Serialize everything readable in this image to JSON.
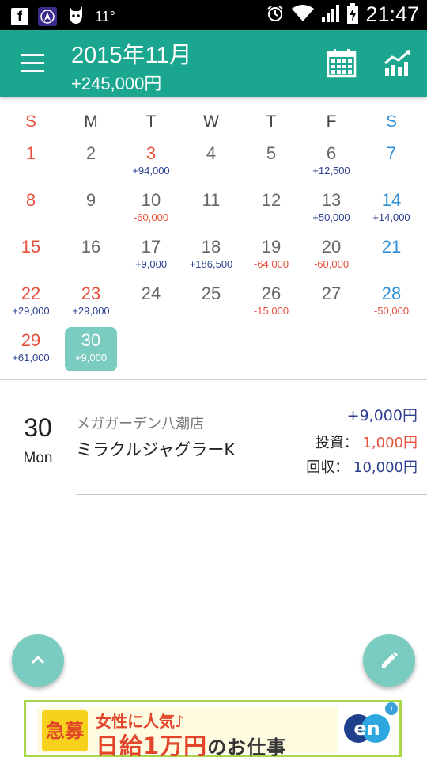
{
  "status_bar": {
    "temperature": "11°",
    "time": "21:47"
  },
  "header": {
    "title": "2015年11月",
    "total": "+245,000円"
  },
  "weekdays": [
    "S",
    "M",
    "T",
    "W",
    "T",
    "F",
    "S"
  ],
  "calendar": {
    "weeks": [
      [
        {
          "day": "1",
          "amount": "",
          "color": "red"
        },
        {
          "day": "2",
          "amount": "",
          "color": "gray"
        },
        {
          "day": "3",
          "amount": "+94,000",
          "color": "red"
        },
        {
          "day": "4",
          "amount": "",
          "color": "gray"
        },
        {
          "day": "5",
          "amount": "",
          "color": "gray"
        },
        {
          "day": "6",
          "amount": "+12,500",
          "color": "gray"
        },
        {
          "day": "7",
          "amount": "",
          "color": "blue"
        }
      ],
      [
        {
          "day": "8",
          "amount": "",
          "color": "red"
        },
        {
          "day": "9",
          "amount": "",
          "color": "gray"
        },
        {
          "day": "10",
          "amount": "-60,000",
          "color": "gray"
        },
        {
          "day": "11",
          "amount": "",
          "color": "gray"
        },
        {
          "day": "12",
          "amount": "",
          "color": "gray"
        },
        {
          "day": "13",
          "amount": "+50,000",
          "color": "gray"
        },
        {
          "day": "14",
          "amount": "+14,000",
          "color": "blue"
        }
      ],
      [
        {
          "day": "15",
          "amount": "",
          "color": "red"
        },
        {
          "day": "16",
          "amount": "",
          "color": "gray"
        },
        {
          "day": "17",
          "amount": "+9,000",
          "color": "gray"
        },
        {
          "day": "18",
          "amount": "+186,500",
          "color": "gray"
        },
        {
          "day": "19",
          "amount": "-64,000",
          "color": "gray"
        },
        {
          "day": "20",
          "amount": "-60,000",
          "color": "gray"
        },
        {
          "day": "21",
          "amount": "",
          "color": "blue"
        }
      ],
      [
        {
          "day": "22",
          "amount": "+29,000",
          "color": "red"
        },
        {
          "day": "23",
          "amount": "+29,000",
          "color": "red"
        },
        {
          "day": "24",
          "amount": "",
          "color": "gray"
        },
        {
          "day": "25",
          "amount": "",
          "color": "gray"
        },
        {
          "day": "26",
          "amount": "-15,000",
          "color": "gray"
        },
        {
          "day": "27",
          "amount": "",
          "color": "gray"
        },
        {
          "day": "28",
          "amount": "-50,000",
          "color": "blue"
        }
      ],
      [
        {
          "day": "29",
          "amount": "+61,000",
          "color": "red"
        },
        {
          "day": "30",
          "amount": "+9,000",
          "color": "gray",
          "selected": true
        }
      ]
    ]
  },
  "entry": {
    "day": "30",
    "weekday": "Mon",
    "store": "メガガーデン八潮店",
    "machine": "ミラクルジャグラーK",
    "profit": "+9,000円",
    "invest_label": "投資：",
    "invest_value": "1,000円",
    "return_label": "回収：",
    "return_value": "10,000円"
  },
  "ad": {
    "badge": "急募",
    "line1": "女性に人気♪",
    "line2_main": "日給1万円",
    "line2_suffix": "のお仕事",
    "logo": "en",
    "info": "i"
  }
}
